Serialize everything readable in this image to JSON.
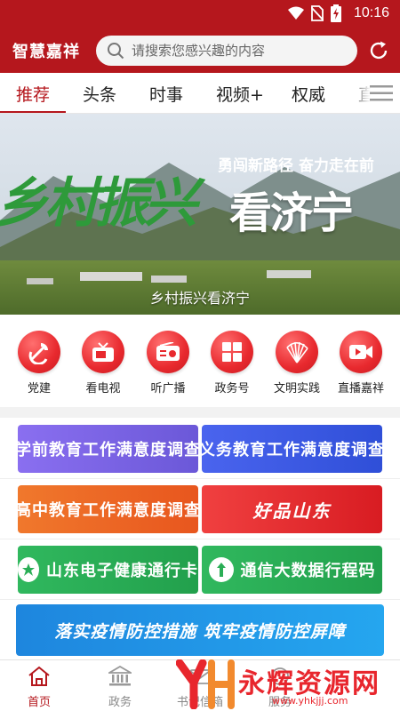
{
  "status_bar": {
    "time": "10:16"
  },
  "header": {
    "app_title": "智慧嘉祥",
    "search_placeholder": "请搜索您感兴趣的内容"
  },
  "tabs": [
    {
      "label": "推荐",
      "active": true
    },
    {
      "label": "头条",
      "active": false
    },
    {
      "label": "时事",
      "active": false
    },
    {
      "label": "视频+",
      "active": false
    },
    {
      "label": "权威",
      "active": false
    },
    {
      "label": "直",
      "active": false
    }
  ],
  "banner": {
    "calligraphy": "乡村振兴",
    "headline": "看济宁",
    "slogan": "勇闯新路径 奋力走在前",
    "caption": "乡村振兴看济宁"
  },
  "quick_links": [
    {
      "label": "党建",
      "icon": "party-emblem-icon"
    },
    {
      "label": "看电视",
      "icon": "tv-icon"
    },
    {
      "label": "听广播",
      "icon": "radio-icon"
    },
    {
      "label": "政务号",
      "icon": "grid-icon"
    },
    {
      "label": "文明实践",
      "icon": "fan-leaf-icon"
    },
    {
      "label": "直播嘉祥",
      "icon": "video-camera-icon"
    }
  ],
  "cards": [
    {
      "label": "学前教育工作满意度调查",
      "color": "#7a63e0"
    },
    {
      "label": "义务教育工作满意度调查",
      "color": "#3b5fe8"
    },
    {
      "label": "高中教育工作满意度调查",
      "color": "#ee6a2a"
    },
    {
      "label": "好品山东",
      "color": "#e8262d"
    },
    {
      "label": "山东电子健康通行卡",
      "color": "#2aae56"
    },
    {
      "label": "通信大数据行程码",
      "color": "#2aae56"
    },
    {
      "label": "落实疫情防控措施 筑牢疫情防控屏障",
      "color": "#1f8fe0"
    }
  ],
  "bottom_nav": [
    {
      "label": "首页",
      "icon": "home-icon",
      "active": true
    },
    {
      "label": "政务",
      "icon": "government-icon",
      "active": false
    },
    {
      "label": "书记信箱",
      "icon": "mailbox-icon",
      "active": false
    },
    {
      "label": "服务",
      "icon": "service-icon",
      "active": false
    }
  ],
  "watermark": {
    "title": "永辉资源网",
    "url": "www.yhkjjj.com"
  },
  "colors": {
    "brand_red": "#b5171d",
    "icon_red": "#e8292e"
  }
}
